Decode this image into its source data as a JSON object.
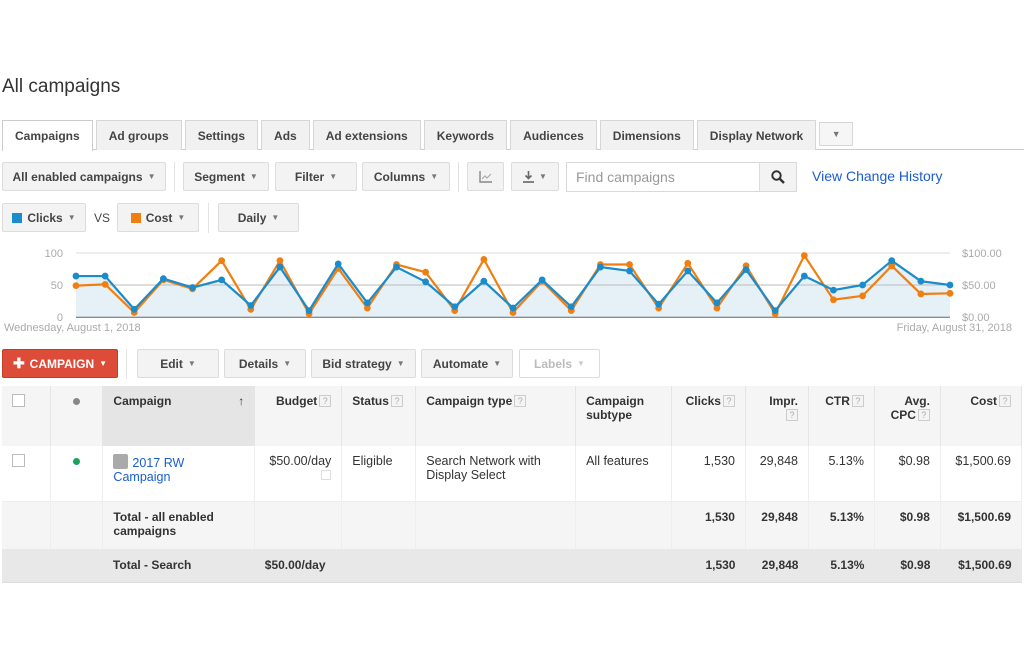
{
  "page_title": "All campaigns",
  "tabs": [
    {
      "label": "Campaigns",
      "active": true
    },
    {
      "label": "Ad groups"
    },
    {
      "label": "Settings"
    },
    {
      "label": "Ads"
    },
    {
      "label": "Ad extensions"
    },
    {
      "label": "Keywords"
    },
    {
      "label": "Audiences"
    },
    {
      "label": "Dimensions"
    },
    {
      "label": "Display Network"
    }
  ],
  "toolbar": {
    "filter_scope": "All enabled campaigns",
    "segment": "Segment",
    "filter": "Filter",
    "columns": "Columns",
    "search_placeholder": "Find campaigns",
    "view_change_history": "View Change History"
  },
  "metrics": {
    "metric1": "Clicks",
    "metric1_color": "#1a8ccc",
    "vs": "VS",
    "metric2": "Cost",
    "metric2_color": "#f07f12",
    "interval": "Daily"
  },
  "chart_data": {
    "type": "line",
    "x_start_label": "Wednesday, August 1, 2018",
    "x_end_label": "Friday, August 31, 2018",
    "x": [
      1,
      2,
      3,
      4,
      5,
      6,
      7,
      8,
      9,
      10,
      11,
      12,
      13,
      14,
      15,
      16,
      17,
      18,
      19,
      20,
      21,
      22,
      23,
      24,
      25,
      26,
      27,
      28,
      29,
      30,
      31
    ],
    "left_axis": {
      "ticks": [
        "0",
        "50",
        "100"
      ],
      "range": [
        0,
        100
      ]
    },
    "right_axis": {
      "ticks": [
        "$0.00",
        "$50.00",
        "$100.00"
      ],
      "range": [
        0,
        100
      ]
    },
    "grid": true,
    "series": [
      {
        "name": "Clicks",
        "axis": "left",
        "color": "#1a8ccc",
        "values": [
          64,
          64,
          12,
          60,
          46,
          58,
          18,
          78,
          10,
          83,
          22,
          78,
          55,
          16,
          56,
          14,
          58,
          16,
          78,
          72,
          20,
          72,
          22,
          74,
          10,
          64,
          42,
          50,
          88,
          56,
          50
        ]
      },
      {
        "name": "Cost",
        "axis": "right",
        "color": "#f07f12",
        "values": [
          49,
          51,
          7,
          58,
          44,
          88,
          12,
          88,
          5,
          76,
          14,
          82,
          70,
          10,
          90,
          7,
          56,
          10,
          82,
          82,
          14,
          84,
          14,
          80,
          5,
          96,
          27,
          33,
          80,
          36,
          37
        ]
      }
    ]
  },
  "actions": {
    "new_campaign": "CAMPAIGN",
    "edit": "Edit",
    "details": "Details",
    "bid_strategy": "Bid strategy",
    "automate": "Automate",
    "labels": "Labels"
  },
  "table": {
    "headers": {
      "campaign": "Campaign",
      "budget": "Budget",
      "status": "Status",
      "campaign_type": "Campaign type",
      "campaign_subtype": "Campaign subtype",
      "clicks": "Clicks",
      "impr": "Impr.",
      "ctr": "CTR",
      "avg_cpc": "Avg. CPC",
      "cost": "Cost"
    },
    "sort_indicator": "↑",
    "help": "?",
    "rows": [
      {
        "campaign": "2017 RW Campaign",
        "budget": "$50.00/day",
        "status": "Eligible",
        "campaign_type": "Search Network with Display Select",
        "campaign_subtype": "All features",
        "clicks": "1,530",
        "impr": "29,848",
        "ctr": "5.13%",
        "avg_cpc": "$0.98",
        "cost": "$1,500.69",
        "status_color": "#1aa260"
      }
    ],
    "total_enabled": {
      "label": "Total - all enabled campaigns",
      "clicks": "1,530",
      "impr": "29,848",
      "ctr": "5.13%",
      "avg_cpc": "$0.98",
      "cost": "$1,500.69"
    },
    "total_search": {
      "label": "Total - Search",
      "budget": "$50.00/day",
      "clicks": "1,530",
      "impr": "29,848",
      "ctr": "5.13%",
      "avg_cpc": "$0.98",
      "cost": "$1,500.69"
    }
  }
}
